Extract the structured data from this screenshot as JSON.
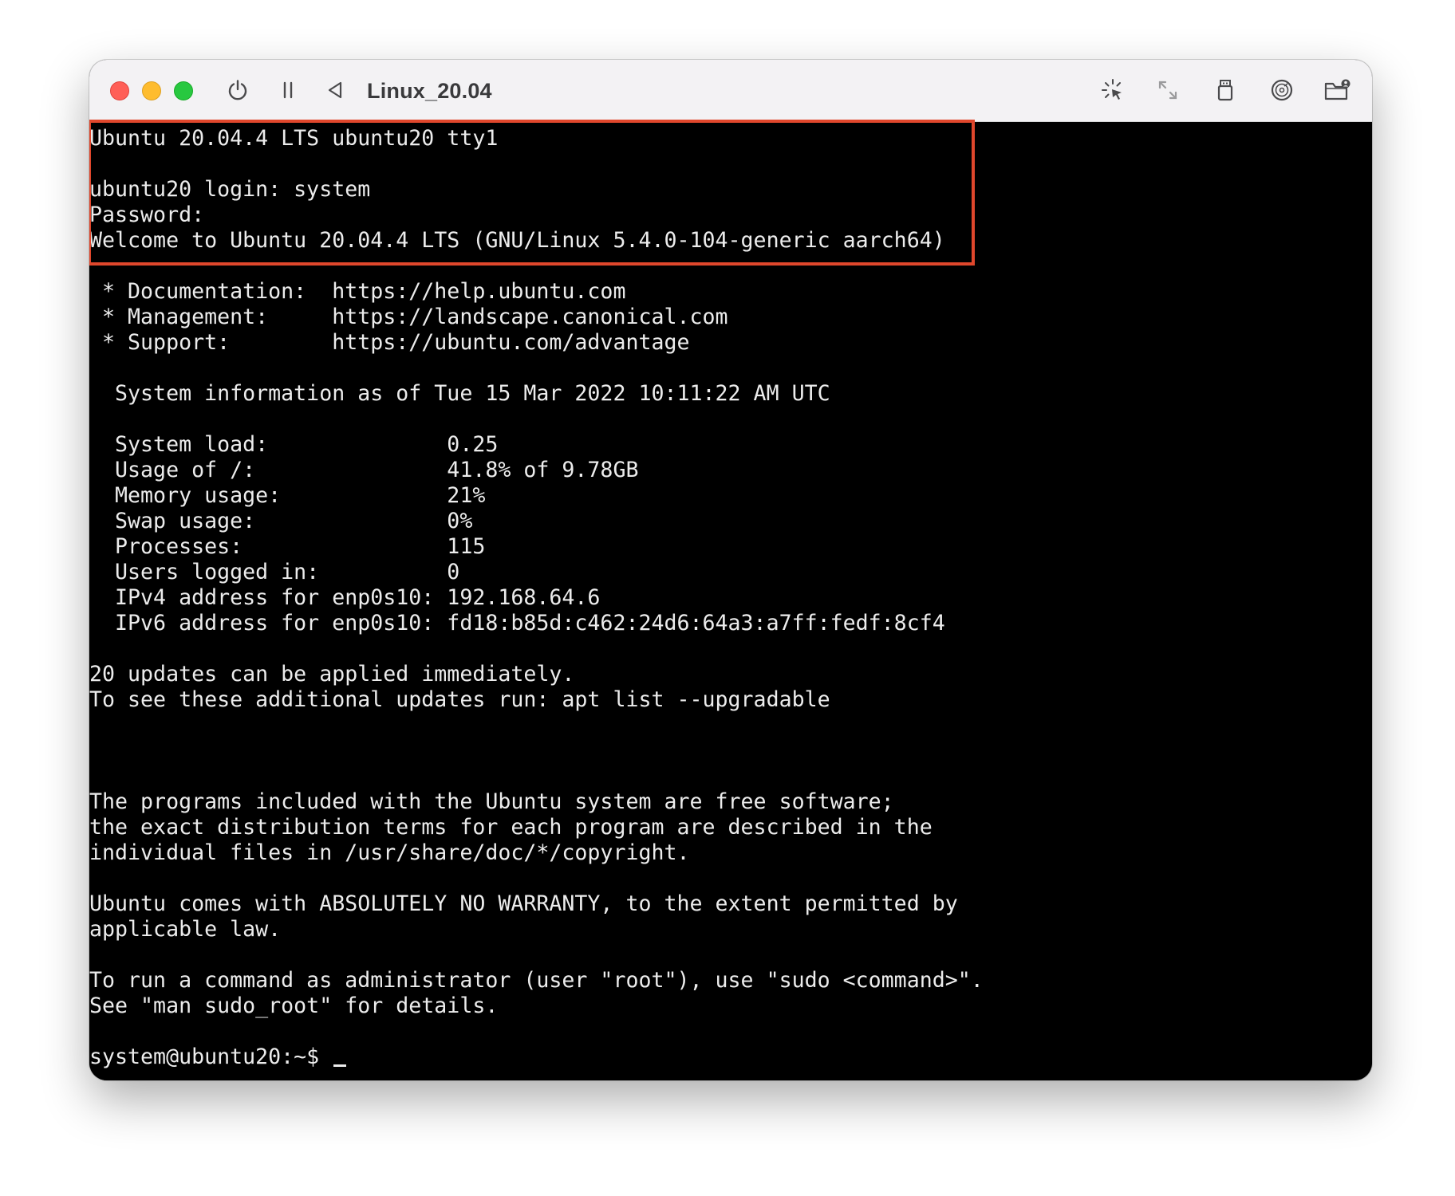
{
  "window": {
    "title": "Linux_20.04"
  },
  "toolbar": {
    "icons": [
      "power-icon",
      "pause-icon",
      "back-icon",
      "capture-cursor-icon",
      "resize-icon",
      "usb-device-icon",
      "disk-icon",
      "shared-folder-icon"
    ]
  },
  "highlight": {
    "color": "#e0472c"
  },
  "terminal": {
    "lines": [
      "Ubuntu 20.04.4 LTS ubuntu20 tty1",
      "",
      "ubuntu20 login: system",
      "Password:",
      "Welcome to Ubuntu 20.04.4 LTS (GNU/Linux 5.4.0-104-generic aarch64)",
      "",
      " * Documentation:  https://help.ubuntu.com",
      " * Management:     https://landscape.canonical.com",
      " * Support:        https://ubuntu.com/advantage",
      "",
      "  System information as of Tue 15 Mar 2022 10:11:22 AM UTC",
      "",
      "  System load:              0.25",
      "  Usage of /:               41.8% of 9.78GB",
      "  Memory usage:             21%",
      "  Swap usage:               0%",
      "  Processes:                115",
      "  Users logged in:          0",
      "  IPv4 address for enp0s10: 192.168.64.6",
      "  IPv6 address for enp0s10: fd18:b85d:c462:24d6:64a3:a7ff:fedf:8cf4",
      "",
      "20 updates can be applied immediately.",
      "To see these additional updates run: apt list --upgradable",
      "",
      "",
      "",
      "The programs included with the Ubuntu system are free software;",
      "the exact distribution terms for each program are described in the",
      "individual files in /usr/share/doc/*/copyright.",
      "",
      "Ubuntu comes with ABSOLUTELY NO WARRANTY, to the extent permitted by",
      "applicable law.",
      "",
      "To run a command as administrator (user \"root\"), use \"sudo <command>\".",
      "See \"man sudo_root\" for details.",
      "",
      "system@ubuntu20:~$ "
    ]
  }
}
